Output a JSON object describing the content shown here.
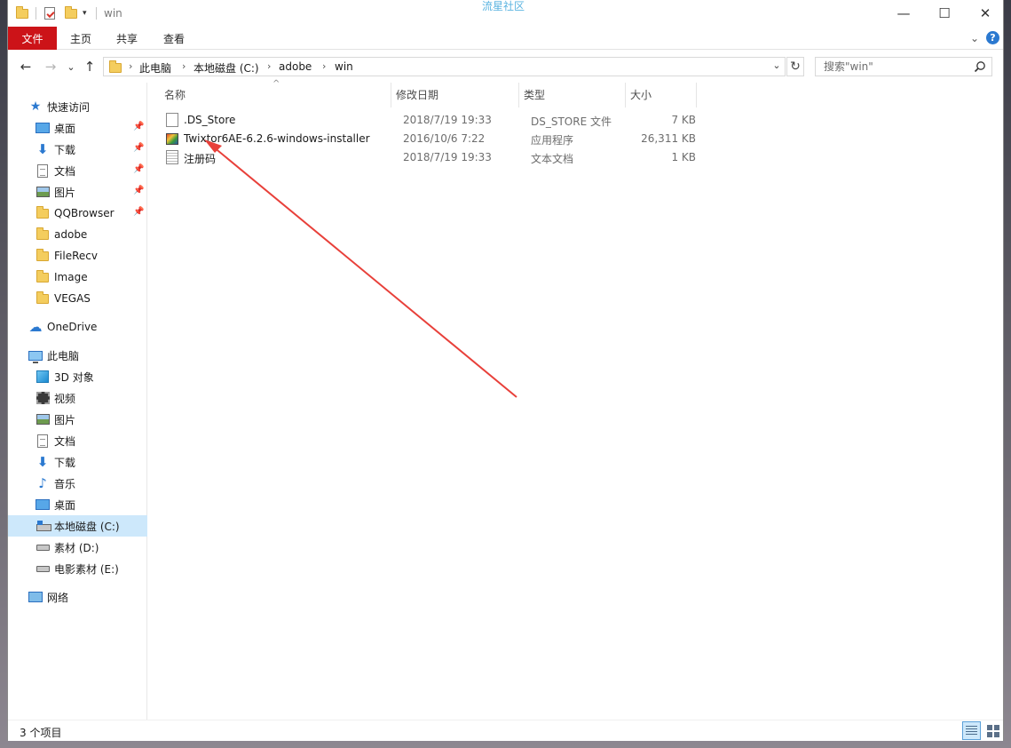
{
  "window": {
    "app_title": "流星社区",
    "folder_title": "win",
    "controls": {
      "minimize": "—",
      "maximize": "☐",
      "close": "✕"
    }
  },
  "ribbon": {
    "tabs": [
      "文件",
      "主页",
      "共享",
      "查看"
    ],
    "expand_glyph": "⌄",
    "help_glyph": "?"
  },
  "address": {
    "back": "←",
    "forward": "→",
    "recent": "⌄",
    "up": "↑",
    "crumbs": [
      "此电脑",
      "本地磁盘 (C:)",
      "adobe",
      "win"
    ],
    "refresh_glyph": "↻",
    "search_placeholder": "搜索\"win\""
  },
  "sidebar": {
    "quick_access": "快速访问",
    "quick_items": [
      {
        "label": "桌面",
        "icon": "desktop-icon",
        "pinned": true
      },
      {
        "label": "下载",
        "icon": "download-icon",
        "pinned": true
      },
      {
        "label": "文档",
        "icon": "document-icon",
        "pinned": true
      },
      {
        "label": "图片",
        "icon": "picture-icon",
        "pinned": true
      },
      {
        "label": "QQBrowser",
        "icon": "folder-icon",
        "pinned": true
      },
      {
        "label": "adobe",
        "icon": "folder-icon",
        "pinned": false
      },
      {
        "label": "FileRecv",
        "icon": "folder-icon",
        "pinned": false
      },
      {
        "label": "Image",
        "icon": "folder-icon",
        "pinned": false
      },
      {
        "label": "VEGAS",
        "icon": "folder-icon",
        "pinned": false
      }
    ],
    "onedrive": "OneDrive",
    "this_pc": "此电脑",
    "pc_items": [
      {
        "label": "3D 对象",
        "icon": "3d-objects-icon"
      },
      {
        "label": "视频",
        "icon": "video-icon"
      },
      {
        "label": "图片",
        "icon": "picture-icon"
      },
      {
        "label": "文档",
        "icon": "document-icon"
      },
      {
        "label": "下载",
        "icon": "download-icon"
      },
      {
        "label": "音乐",
        "icon": "music-icon"
      },
      {
        "label": "桌面",
        "icon": "desktop-icon"
      },
      {
        "label": "本地磁盘 (C:)",
        "icon": "system-drive-icon",
        "selected": true
      },
      {
        "label": "素材 (D:)",
        "icon": "drive-icon"
      },
      {
        "label": "电影素材 (E:)",
        "icon": "drive-icon"
      }
    ],
    "network": "网络"
  },
  "columns": [
    "名称",
    "修改日期",
    "类型",
    "大小"
  ],
  "files": [
    {
      "name": ".DS_Store",
      "date": "2018/7/19 19:33",
      "type": "DS_STORE 文件",
      "size": "7 KB",
      "icon": "blank-file-icon"
    },
    {
      "name": "Twixtor6AE-6.2.6-windows-installer",
      "date": "2016/10/6 7:22",
      "type": "应用程序",
      "size": "26,311 KB",
      "icon": "installer-icon"
    },
    {
      "name": "注册码",
      "date": "2018/7/19 19:33",
      "type": "文本文档",
      "size": "1 KB",
      "icon": "text-file-icon"
    }
  ],
  "status": {
    "item_count": "3 个项目"
  },
  "colors": {
    "file_tab": "#cc1318",
    "selection": "#cde8fb",
    "annotation_arrow": "#e8403a"
  }
}
